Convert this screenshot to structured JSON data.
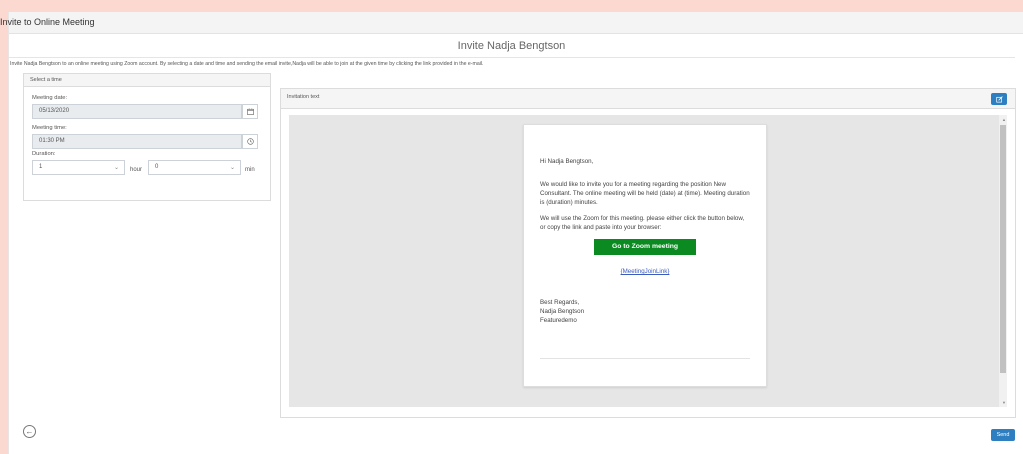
{
  "window": {
    "title": "Invite to Online Meeting"
  },
  "heading": "Invite Nadja Bengtson",
  "description": "Invite Nadja Bengtson to an online meeting using Zoom account. By selecting a date and time and sending the email invite,Nadja will be able to join at the given time by clicking the link provided in the e-mail.",
  "time_panel": {
    "title": "Select a time",
    "date_label": "Meeting date:",
    "date_value": "05/13/2020",
    "time_label": "Meeting time:",
    "time_value": "01:30 PM",
    "duration_label": "Duration:",
    "hours_value": "1",
    "hours_unit": "hour",
    "minutes_value": "0",
    "minutes_unit": "min"
  },
  "invitation_panel": {
    "title": "Invitation text",
    "email": {
      "greeting": "Hi Nadja Bengtson,",
      "paragraph1": "We would like to invite you for a meeting regarding the position New Consultant. The online meeting will be held (date) at (time). Meeting duration is (duration) minutes.",
      "paragraph2": "We will use the Zoom for this meeting. please either click the button below, or copy the link and paste into your browser:",
      "button_label": "Go to Zoom meeting",
      "join_link": "{MeetingJoinLink}",
      "closing": "Best Regards,",
      "sender_name": "Nadja Bengtson",
      "company": "Featuredemo"
    }
  },
  "footer": {
    "send_label": "Send"
  },
  "icons": {
    "calendar": "calendar-icon",
    "clock": "clock-icon",
    "edit": "edit-icon",
    "back": "back-arrow-icon",
    "chevron": "chevron-down-icon"
  },
  "colors": {
    "primary": "#2d7fc1",
    "zoom_button": "#0b8a22",
    "background": "#fcd9d0"
  }
}
